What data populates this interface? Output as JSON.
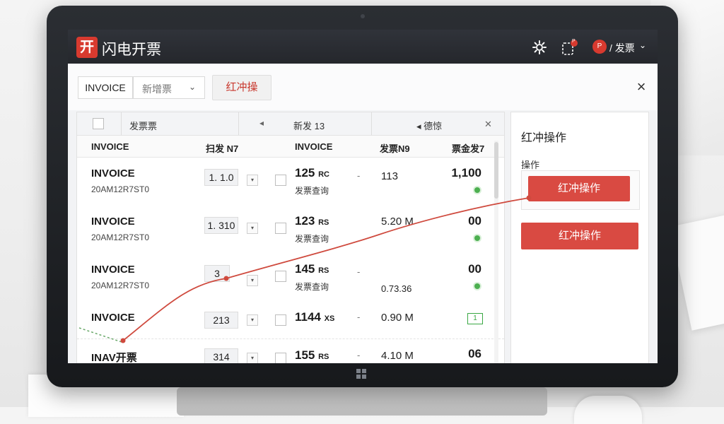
{
  "app": {
    "logo_char": "开",
    "title": "闪电开票",
    "user_avatar": "P",
    "user_name": "/ 发票",
    "notification_badge": "P"
  },
  "toolbar": {
    "invoice_label": "INVOICE",
    "filter_select": "新增票",
    "red_tab": "红冲操",
    "close_symbol": "×"
  },
  "filter_row": {
    "col1": "发票票",
    "col2": "新发 13",
    "col3": "◂ 德惊"
  },
  "table_headers": [
    "INVOICE",
    "扫发 N7",
    "INVOICE",
    "发票N9",
    "票金发7"
  ],
  "rows": [
    {
      "name": "INVOICE",
      "id": "20AM12R7ST0",
      "qty": "1. 1.0",
      "price": "125",
      "price_unit": "RC",
      "sub": "发票查询",
      "dash": "-",
      "mid": "113",
      "mid2": "",
      "value": "1,100",
      "status": "dot"
    },
    {
      "name": "INVOICE",
      "id": "20AM12R7ST0",
      "qty": "1. 310",
      "price": "123",
      "price_unit": "RS",
      "sub": "发票查询",
      "dash": "",
      "mid": "5.20 M",
      "mid2": "",
      "value": "00",
      "status": "dot"
    },
    {
      "name": "INVOICE",
      "id": "20AM12R7ST0",
      "qty": "3",
      "price": "145",
      "price_unit": "RS",
      "sub": "发票查询",
      "dash": "-",
      "mid": "",
      "mid2": "0.73.36",
      "value": "00",
      "status": "dot"
    },
    {
      "name": "INVOICE",
      "id": "",
      "qty": "213",
      "price": "1144",
      "price_unit": "XS",
      "sub": "",
      "dash": "-",
      "mid": "0.90 M",
      "mid2": "",
      "value": "",
      "status": "box",
      "status_text": "1"
    },
    {
      "name": "INAV开票",
      "id": "",
      "qty": "314",
      "price": "155",
      "price_unit": "RS",
      "sub": "",
      "dash": "-",
      "mid": "4.10 M",
      "mid2": "",
      "value": "06",
      "status": "none"
    }
  ],
  "side_panel": {
    "title": "红冲操作",
    "label": "操作",
    "button_primary": "红冲操作",
    "button_secondary": "红冲操作"
  },
  "colors": {
    "accent_red": "#d94a42",
    "header_dark": "#2b2e33",
    "status_green": "#4caf50"
  }
}
